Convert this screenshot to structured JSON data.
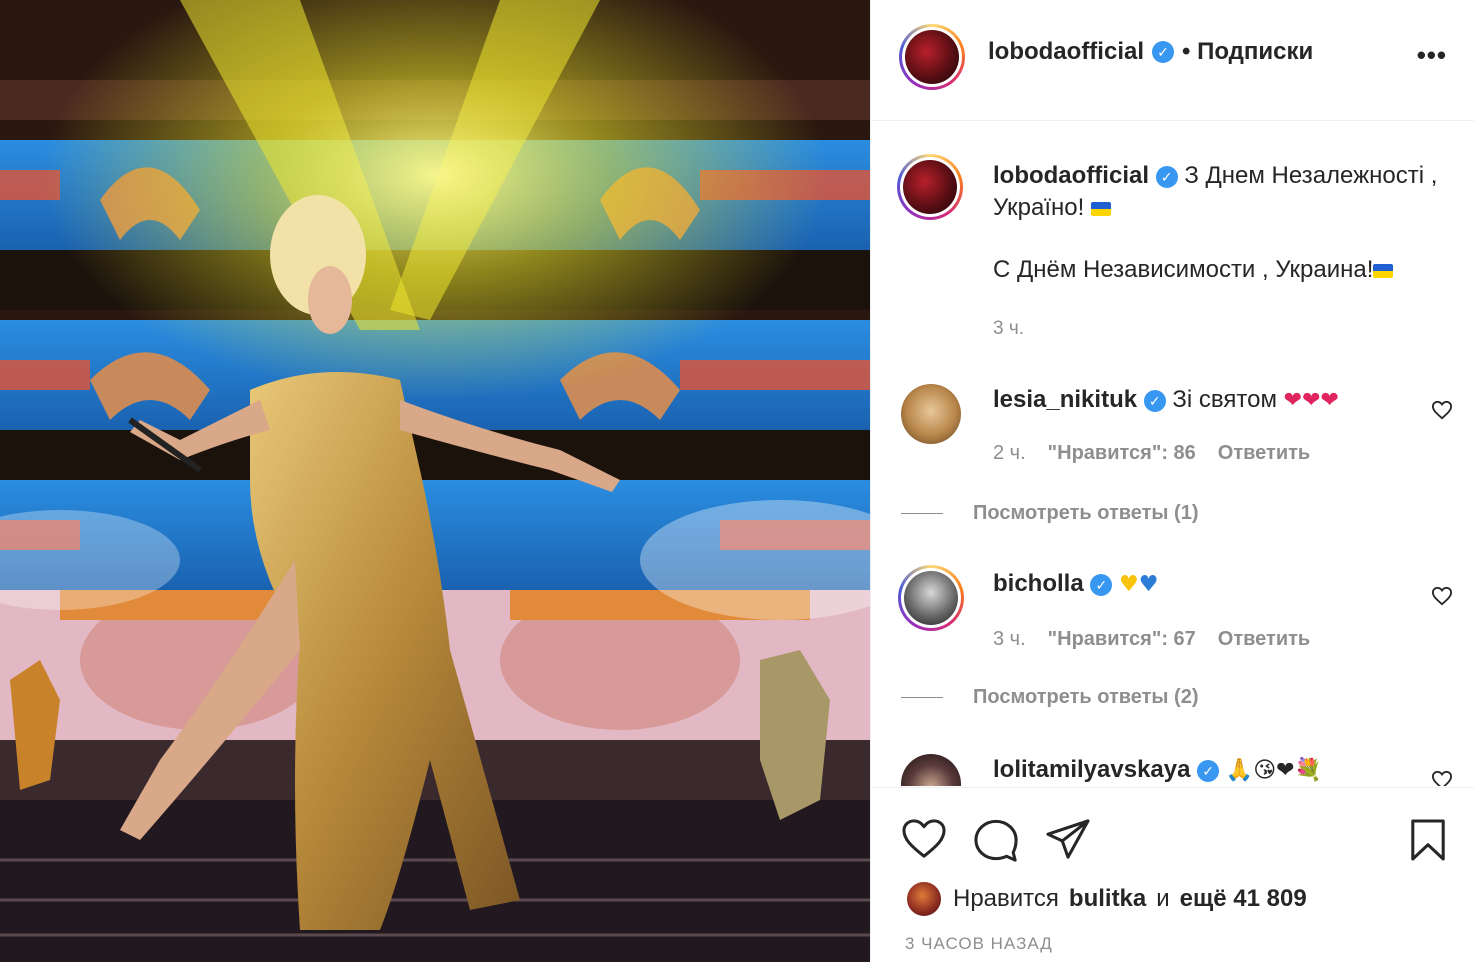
{
  "post": {
    "author": "lobodaofficial",
    "follow_status": "Подписки",
    "more_label": "•••"
  },
  "caption": {
    "username": "lobodaofficial",
    "line1": "З Днем Незалежності , Україно!",
    "line2": "С Днём Независимости , Украина!",
    "time": "3 ч."
  },
  "comments": [
    {
      "username": "lesia_nikituk",
      "text": "Зі святом",
      "emoji": "❤❤❤",
      "time": "2 ч.",
      "likes": "\"Нравится\": 86",
      "reply": "Ответить",
      "view_replies": "Посмотреть ответы (1)"
    },
    {
      "username": "bicholla",
      "text": "",
      "emoji_yellow": "♥",
      "emoji_blue": "♥",
      "time": "3 ч.",
      "likes": "\"Нравится\": 67",
      "reply": "Ответить",
      "view_replies": "Посмотреть ответы (2)"
    },
    {
      "username": "lolitamilyavskaya",
      "emoji": "🙏😘❤💐"
    }
  ],
  "likes": {
    "prefix": "Нравится",
    "user": "bulitka",
    "and": "и",
    "rest": "ещё 41 809"
  },
  "posted_ago": "3 часов назад",
  "icons": [
    "heart-icon",
    "comment-icon",
    "share-icon",
    "bookmark-icon",
    "more-icon",
    "verified-icon"
  ],
  "colors": {
    "verified": "#3897f0",
    "meta": "#8e8e8e",
    "text": "#262626"
  }
}
